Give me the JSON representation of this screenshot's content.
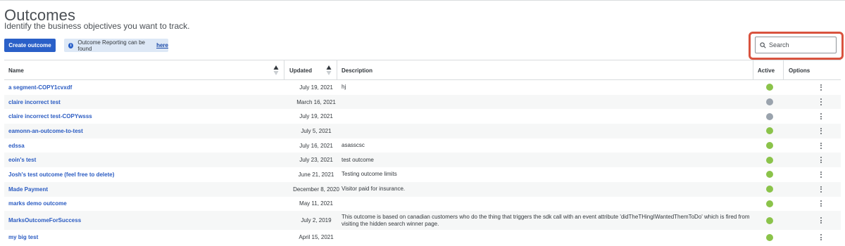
{
  "header": {
    "title": "Outcomes",
    "subtitle": "Identify the business objectives you want to track."
  },
  "toolbar": {
    "create_label": "Create outcome",
    "info_text": "Outcome Reporting can be found",
    "info_link": "here",
    "search_placeholder": "Search"
  },
  "colors": {
    "primary": "#2a60c8",
    "link": "#2a5bc2",
    "active_on": "#8bc34a",
    "active_off": "#9aa3ad",
    "highlight": "#d9533f"
  },
  "table": {
    "columns": {
      "name": "Name",
      "updated": "Updated",
      "description": "Description",
      "active": "Active",
      "options": "Options"
    },
    "rows": [
      {
        "name": "a segment-COPY1cvxdf",
        "updated": "July 19, 2021",
        "description": "hj",
        "active": true
      },
      {
        "name": "claire incorrect test",
        "updated": "March 16, 2021",
        "description": "",
        "active": false
      },
      {
        "name": "claire incorrect test-COPYwsss",
        "updated": "July 19, 2021",
        "description": "",
        "active": false
      },
      {
        "name": "eamonn-an-outcome-to-test",
        "updated": "July 5, 2021",
        "description": "",
        "active": true
      },
      {
        "name": "edssa",
        "updated": "July 16, 2021",
        "description": "asasscsc",
        "active": true
      },
      {
        "name": "eoin's test",
        "updated": "July 23, 2021",
        "description": "test outcome",
        "active": true
      },
      {
        "name": "Josh's test outcome (feel free to delete)",
        "updated": "June 21, 2021",
        "description": "Testing outcome limits",
        "active": true
      },
      {
        "name": "Made Payment",
        "updated": "December 8, 2020",
        "description": "Visitor paid for insurance.",
        "active": true
      },
      {
        "name": "marks demo outcome",
        "updated": "May 11, 2021",
        "description": "",
        "active": true
      },
      {
        "name": "MarksOutcomeForSuccess",
        "updated": "July 2, 2019",
        "description": "This outcome is based on canadian customers who do the thing that triggers the sdk call with an event attribute 'didTheTHingIWantedThemToDo' which is fired from visiting the hidden search winner page.",
        "active": true
      },
      {
        "name": "my big test",
        "updated": "April 15, 2021",
        "description": "",
        "active": true
      }
    ]
  }
}
